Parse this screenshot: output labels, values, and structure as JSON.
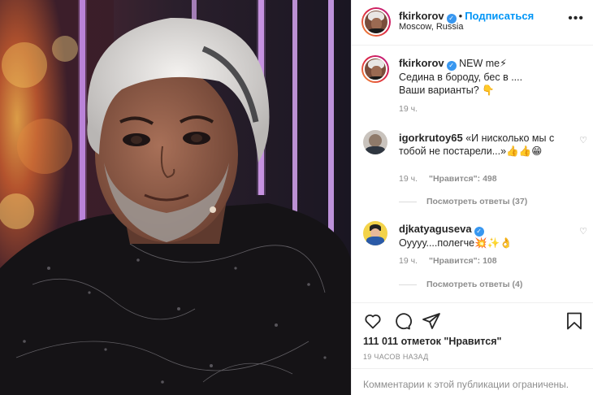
{
  "post_author": {
    "username": "fkirkorov",
    "follow_label": "Подписаться",
    "location": "Moscow, Russia",
    "more_label": "•••"
  },
  "caption": {
    "username": "fkirkorov",
    "text_line1": "NEW me⚡",
    "text_line2": "Седина в бороду, бес в ....",
    "text_line3": "Ваши варианты? 👇",
    "time": "19 ч."
  },
  "comments": [
    {
      "username": "igorkrutoy65",
      "text": "«И нисколько мы с тобой не постарели...»👍👍😁",
      "time": "19 ч.",
      "likes": "\"Нравится\": 498",
      "replies": "Посмотреть ответы (37)"
    },
    {
      "username": "djkatyaguseva",
      "text": "Оуууу....полегче💥✨👌",
      "time": "19 ч.",
      "likes": "\"Нравится\": 108",
      "replies": "Посмотреть ответы (4)"
    }
  ],
  "actions": {
    "likes_count": "111 011 отметок \"Нравится\"",
    "time_ago": "19 ЧАСОВ НАЗАД",
    "comments_limited": "Комментарии к этой публикации ограничены."
  },
  "icons": {
    "verified": "verified-badge-icon",
    "like": "heart-icon",
    "comment": "comment-bubble-icon",
    "share": "paper-plane-icon",
    "save": "bookmark-icon"
  },
  "colors": {
    "link": "#0095f6",
    "verified": "#3897f0",
    "muted": "#8e8e8e",
    "divider": "#efefef"
  }
}
